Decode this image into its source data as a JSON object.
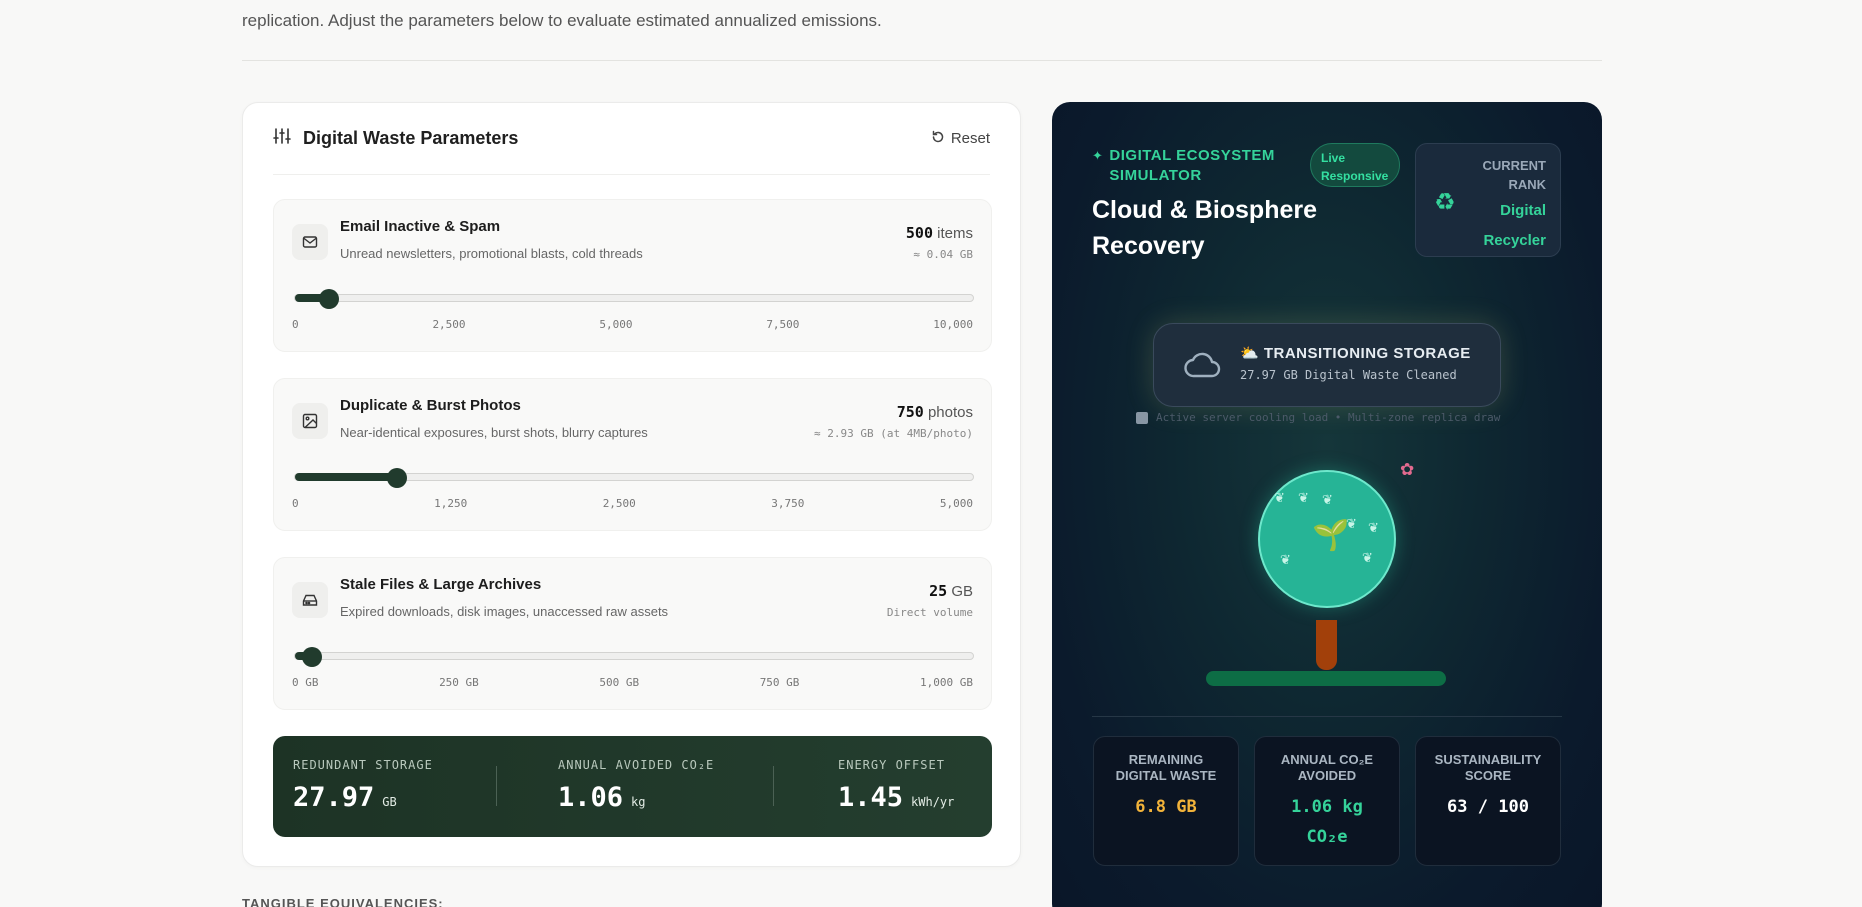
{
  "intro": {
    "line1": "replication. Adjust the parameters below to evaluate estimated annualized emissions."
  },
  "params": {
    "title": "Digital Waste Parameters",
    "reset_label": "Reset",
    "items": [
      {
        "title": "Email Inactive & Spam",
        "desc": "Unread newsletters, promotional blasts, cold threads",
        "value": "500",
        "unit": "items",
        "sub": "≈ 0.04 GB",
        "fraction": 0.05,
        "ticks": [
          "0",
          "2,500",
          "5,000",
          "7,500",
          "10,000"
        ]
      },
      {
        "title": "Duplicate & Burst Photos",
        "desc": "Near-identical exposures, burst shots, blurry captures",
        "value": "750",
        "unit": "photos",
        "sub": "≈ 2.93 GB (at 4MB/photo)",
        "fraction": 0.15,
        "ticks": [
          "0",
          "1,250",
          "2,500",
          "3,750",
          "5,000"
        ]
      },
      {
        "title": "Stale Files & Large Archives",
        "desc": "Expired downloads, disk images, unaccessed raw assets",
        "value": "25",
        "unit": "GB",
        "sub": "Direct volume",
        "fraction": 0.025,
        "ticks": [
          "0 GB",
          "250 GB",
          "500 GB",
          "750 GB",
          "1,000 GB"
        ]
      }
    ]
  },
  "summary": {
    "storage_label": "REDUNDANT STORAGE",
    "storage_value": "27.97",
    "storage_unit": "GB",
    "co2_label": "ANNUAL AVOIDED CO₂E",
    "co2_value": "1.06",
    "co2_unit": "kg",
    "energy_label": "ENERGY OFFSET",
    "energy_value": "1.45",
    "energy_unit": "kWh/yr"
  },
  "tangible_label": "TANGIBLE EQUIVALENCIES:",
  "sim": {
    "tag": "DIGITAL ECOSYSTEM SIMULATOR",
    "title": "Cloud & Biosphere Recovery",
    "live_label": "Live Responsive",
    "rank_label": "CURRENT RANK",
    "rank_value": "Digital Recycler",
    "status_title": "TRANSITIONING STORAGE",
    "status_sub": "27.97 GB Digital Waste Cleaned",
    "meta": "Active server cooling load • Multi-zone replica draw",
    "stats": [
      {
        "label": "REMAINING DIGITAL WASTE",
        "value": "6.8 GB",
        "color": "#f2b33a"
      },
      {
        "label": "ANNUAL CO₂E AVOIDED",
        "value": "1.06 kg CO₂e",
        "color": "#35d39a"
      },
      {
        "label": "SUSTAINABILITY SCORE",
        "value": "63 / 100",
        "color": "#ffffff"
      }
    ]
  },
  "colors": {
    "accent_dark": "#213b2d",
    "accent_green": "#35d39a",
    "panel_bg": "#0b1a2c"
  }
}
